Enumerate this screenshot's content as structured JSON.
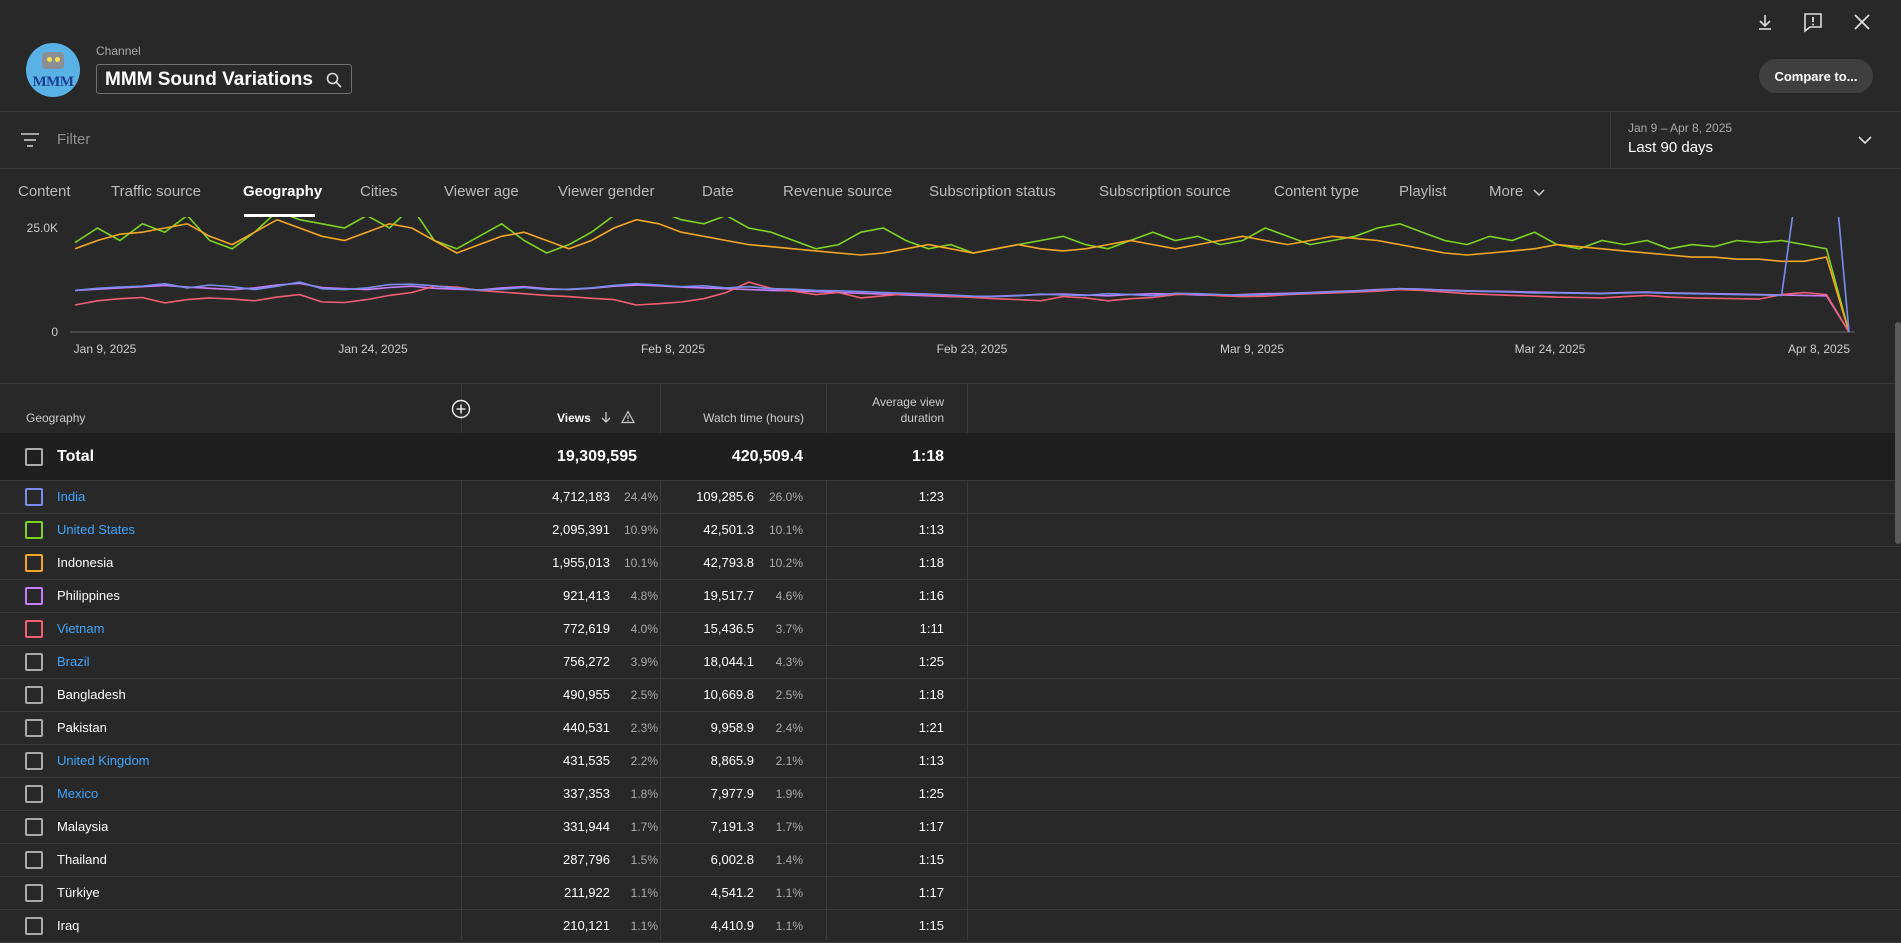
{
  "header": {
    "channel_label": "Channel",
    "channel_name": "MMM Sound Variations",
    "avatar_text": "MMM",
    "compare_label": "Compare to..."
  },
  "filter": {
    "placeholder": "Filter"
  },
  "date_range": {
    "range": "Jan 9 – Apr 8, 2025",
    "label": "Last 90 days"
  },
  "tabs": [
    {
      "label": "Content"
    },
    {
      "label": "Traffic source"
    },
    {
      "label": "Geography"
    },
    {
      "label": "Cities"
    },
    {
      "label": "Viewer age"
    },
    {
      "label": "Viewer gender"
    },
    {
      "label": "Date"
    },
    {
      "label": "Revenue source"
    },
    {
      "label": "Subscription status"
    },
    {
      "label": "Subscription source"
    },
    {
      "label": "Content type"
    },
    {
      "label": "Playlist"
    },
    {
      "label": "More"
    }
  ],
  "active_tab": "Geography",
  "chart_data": {
    "type": "line",
    "x_tick_labels": [
      "Jan 9, 2025",
      "Jan 24, 2025",
      "Feb 8, 2025",
      "Feb 23, 2025",
      "Mar 9, 2025",
      "Mar 24, 2025",
      "Apr 8, 2025"
    ],
    "y_tick_labels": [
      "0",
      "25.0K"
    ],
    "ylim": [
      0,
      50000
    ],
    "grid": false,
    "series": [
      {
        "name": "India",
        "color": "#7b8cf0",
        "values": [
          10000,
          10500,
          10800,
          11000,
          11600,
          10600,
          11300,
          10900,
          10200,
          11000,
          12000,
          10400,
          10200,
          10600,
          11400,
          11500,
          11100,
          10500,
          10100,
          10300,
          10700,
          10200,
          10300,
          10600,
          11200,
          11600,
          11300,
          10900,
          11100,
          10600,
          10900,
          10400,
          10300,
          10000,
          9900,
          9700,
          9500,
          9300,
          9100,
          8900,
          8600,
          8500,
          8700,
          9100,
          8900,
          8800,
          9200,
          9000,
          8700,
          9300,
          9200,
          9000,
          8800,
          9000,
          9100,
          9400,
          9600,
          9800,
          10100,
          10400,
          10300,
          10000,
          9800,
          9700,
          9600,
          9400,
          9400,
          9300,
          9200,
          9400,
          9500,
          9300,
          9200,
          9100,
          9000,
          8900,
          8800,
          48000,
          60000,
          0
        ]
      },
      {
        "name": "United States",
        "color": "#7ed321",
        "values": [
          21500,
          25000,
          22000,
          26000,
          24000,
          28000,
          22000,
          20000,
          24000,
          29000,
          27000,
          26000,
          25000,
          28000,
          25000,
          30000,
          22000,
          20000,
          23000,
          26000,
          22000,
          19000,
          21000,
          24000,
          28000,
          30000,
          29000,
          27000,
          26000,
          28000,
          25000,
          24000,
          22000,
          20000,
          21000,
          24000,
          25000,
          22000,
          20000,
          21000,
          19000,
          20000,
          21000,
          22000,
          23000,
          21000,
          20000,
          22000,
          24000,
          22000,
          23000,
          21000,
          22000,
          25000,
          23000,
          21000,
          22000,
          23000,
          25000,
          26000,
          24000,
          22000,
          21000,
          23000,
          22000,
          24000,
          21000,
          20000,
          22000,
          21000,
          22000,
          20000,
          21000,
          20500,
          22000,
          21500,
          22000,
          21000,
          20000,
          0
        ]
      },
      {
        "name": "Indonesia",
        "color": "#f5a623",
        "values": [
          20000,
          22000,
          23500,
          24000,
          25000,
          26000,
          23000,
          21000,
          24000,
          27000,
          25000,
          23000,
          22000,
          24000,
          26000,
          25000,
          22000,
          19000,
          21000,
          23000,
          24000,
          22000,
          20000,
          22000,
          25000,
          27000,
          26000,
          24000,
          23000,
          22000,
          21000,
          20500,
          20000,
          19500,
          19000,
          18500,
          19000,
          20000,
          21000,
          20000,
          19000,
          20000,
          21000,
          20000,
          19500,
          20000,
          21000,
          22000,
          21000,
          20000,
          21000,
          22000,
          23000,
          22000,
          21000,
          22000,
          23000,
          22500,
          22000,
          21000,
          20000,
          19000,
          18500,
          19000,
          19500,
          20000,
          21000,
          20500,
          20000,
          19500,
          19000,
          18500,
          18000,
          18000,
          17500,
          17500,
          17000,
          17000,
          18000,
          0
        ]
      },
      {
        "name": "Philippines",
        "color": "#c77dff",
        "values": [
          10000,
          10300,
          10600,
          10900,
          11200,
          10800,
          10500,
          10200,
          10600,
          11300,
          11700,
          10700,
          10400,
          10200,
          10700,
          11000,
          10500,
          10300,
          10100,
          10600,
          10900,
          10400,
          10200,
          10500,
          11000,
          11300,
          11100,
          10800,
          10600,
          10400,
          10200,
          10000,
          9900,
          9700,
          9500,
          9300,
          9100,
          8900,
          8700,
          8500,
          8400,
          8600,
          8800,
          9000,
          9100,
          8900,
          8700,
          9000,
          9200,
          9100,
          8900,
          8800,
          9000,
          9200,
          9300,
          9500,
          9700,
          9900,
          10200,
          10400,
          10300,
          10100,
          9900,
          9800,
          9700,
          9600,
          9500,
          9400,
          9300,
          9500,
          9600,
          9400,
          9300,
          9200,
          9100,
          9000,
          8900,
          8800,
          8700,
          0
        ]
      },
      {
        "name": "Vietnam",
        "color": "#f25f75",
        "values": [
          6500,
          7500,
          8000,
          8300,
          7000,
          7800,
          8200,
          7900,
          7500,
          8400,
          9000,
          7200,
          7100,
          7800,
          8800,
          9500,
          11000,
          10800,
          10000,
          9600,
          9200,
          8800,
          8500,
          8100,
          7800,
          6500,
          6800,
          7200,
          8000,
          9500,
          12000,
          10500,
          9800,
          9000,
          9500,
          8200,
          8700,
          9200,
          8900,
          8600,
          8300,
          8000,
          7800,
          7500,
          8500,
          8200,
          7500,
          8000,
          8300,
          9000,
          9200,
          8700,
          8500,
          8600,
          9000,
          9200,
          9400,
          9600,
          9800,
          10200,
          10000,
          9600,
          9200,
          9000,
          8800,
          8600,
          8400,
          8300,
          8200,
          8500,
          8800,
          8400,
          8200,
          8100,
          8000,
          7900,
          9000,
          9500,
          9000,
          0
        ]
      }
    ]
  },
  "table": {
    "headers": {
      "geography": "Geography",
      "views": "Views",
      "watch_time": "Watch time (hours)",
      "avg_duration_l1": "Average view",
      "avg_duration_l2": "duration"
    },
    "total": {
      "label": "Total",
      "views": "19,309,595",
      "watch_time": "420,509.4",
      "avg": "1:18"
    },
    "rows": [
      {
        "name": "India",
        "link": true,
        "color": "#7b8cf0",
        "views": "4,712,183",
        "views_pct": "24.4%",
        "watch": "109,285.6",
        "watch_pct": "26.0%",
        "avg": "1:23"
      },
      {
        "name": "United States",
        "link": true,
        "color": "#7ed321",
        "views": "2,095,391",
        "views_pct": "10.9%",
        "watch": "42,501.3",
        "watch_pct": "10.1%",
        "avg": "1:13"
      },
      {
        "name": "Indonesia",
        "link": false,
        "color": "#f5a623",
        "views": "1,955,013",
        "views_pct": "10.1%",
        "watch": "42,793.8",
        "watch_pct": "10.2%",
        "avg": "1:18"
      },
      {
        "name": "Philippines",
        "link": false,
        "color": "#c77dff",
        "views": "921,413",
        "views_pct": "4.8%",
        "watch": "19,517.7",
        "watch_pct": "4.6%",
        "avg": "1:16"
      },
      {
        "name": "Vietnam",
        "link": true,
        "color": "#f25f75",
        "views": "772,619",
        "views_pct": "4.0%",
        "watch": "15,436.5",
        "watch_pct": "3.7%",
        "avg": "1:11"
      },
      {
        "name": "Brazil",
        "link": true,
        "color": "#aaaaaa",
        "views": "756,272",
        "views_pct": "3.9%",
        "watch": "18,044.1",
        "watch_pct": "4.3%",
        "avg": "1:25"
      },
      {
        "name": "Bangladesh",
        "link": false,
        "color": "#aaaaaa",
        "views": "490,955",
        "views_pct": "2.5%",
        "watch": "10,669.8",
        "watch_pct": "2.5%",
        "avg": "1:18"
      },
      {
        "name": "Pakistan",
        "link": false,
        "color": "#aaaaaa",
        "views": "440,531",
        "views_pct": "2.3%",
        "watch": "9,958.9",
        "watch_pct": "2.4%",
        "avg": "1:21"
      },
      {
        "name": "United Kingdom",
        "link": true,
        "color": "#aaaaaa",
        "views": "431,535",
        "views_pct": "2.2%",
        "watch": "8,865.9",
        "watch_pct": "2.1%",
        "avg": "1:13"
      },
      {
        "name": "Mexico",
        "link": true,
        "color": "#aaaaaa",
        "views": "337,353",
        "views_pct": "1.8%",
        "watch": "7,977.9",
        "watch_pct": "1.9%",
        "avg": "1:25"
      },
      {
        "name": "Malaysia",
        "link": false,
        "color": "#aaaaaa",
        "views": "331,944",
        "views_pct": "1.7%",
        "watch": "7,191.3",
        "watch_pct": "1.7%",
        "avg": "1:17"
      },
      {
        "name": "Thailand",
        "link": false,
        "color": "#aaaaaa",
        "views": "287,796",
        "views_pct": "1.5%",
        "watch": "6,002.8",
        "watch_pct": "1.4%",
        "avg": "1:15"
      },
      {
        "name": "Türkiye",
        "link": false,
        "color": "#aaaaaa",
        "views": "211,922",
        "views_pct": "1.1%",
        "watch": "4,541.2",
        "watch_pct": "1.1%",
        "avg": "1:17"
      },
      {
        "name": "Iraq",
        "link": false,
        "color": "#aaaaaa",
        "views": "210,121",
        "views_pct": "1.1%",
        "watch": "4,410.9",
        "watch_pct": "1.1%",
        "avg": "1:15"
      }
    ]
  }
}
